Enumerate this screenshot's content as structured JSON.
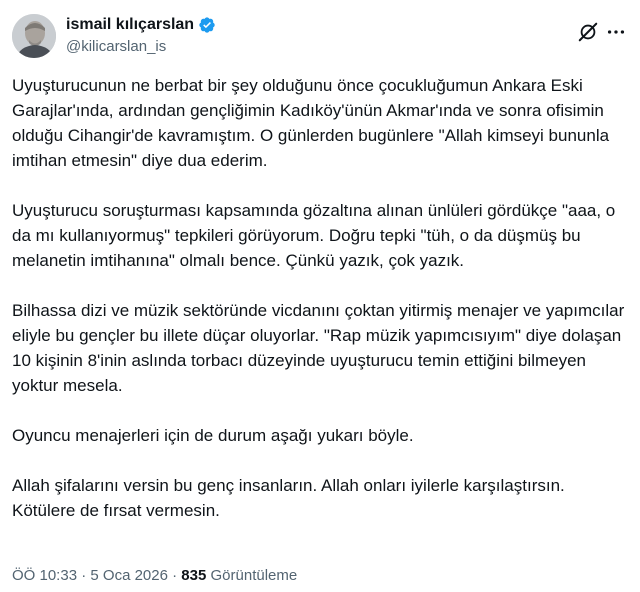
{
  "author": {
    "display_name": "ismail kılıçarslan",
    "handle": "@kilicarslan_is",
    "verified": true
  },
  "icons": {
    "verified": "verified-badge-icon",
    "grok": "grok-icon",
    "more": "more-icon"
  },
  "colors": {
    "verified_blue": "#1d9bf0",
    "text": "#0f1419",
    "muted": "#536471"
  },
  "tweet": {
    "paragraphs": [
      "Uyuşturucunun ne berbat bir şey olduğunu önce çocukluğumun Ankara Eski Garajlar'ında, ardından gençliğimin Kadıköy'ünün Akmar'ında ve sonra ofisimin olduğu Cihangir'de kavramıştım. O günlerden bugünlere \"Allah kimseyi bununla imtihan etmesin\" diye dua ederim.",
      "Uyuşturucu soruşturması kapsamında gözaltına alınan ünlüleri gördükçe \"aaa, o da mı kullanıyormuş\" tepkileri görüyorum. Doğru tepki \"tüh, o da düşmüş bu melanetin imtihanına\" olmalı bence. Çünkü yazık, çok yazık.",
      "Bilhassa dizi ve müzik sektöründe vicdanını çoktan yitirmiş menajer ve yapımcılar eliyle bu gençler bu illete düçar oluyorlar. \"Rap müzik yapımcısıyım\" diye dolaşan 10 kişinin 8'inin aslında torbacı düzeyinde uyuşturucu temin ettiğini bilmeyen yoktur mesela.",
      "Oyuncu menajerleri için de durum aşağı yukarı böyle.",
      "Allah şifalarını versin bu genç insanların. Allah onları iyilerle karşılaştırsın. Kötülere de fırsat vermesin."
    ]
  },
  "meta": {
    "time": "ÖÖ 10:33",
    "separator": "·",
    "date": "5 Oca 2026",
    "views_count": "835",
    "views_label": "Görüntüleme"
  }
}
